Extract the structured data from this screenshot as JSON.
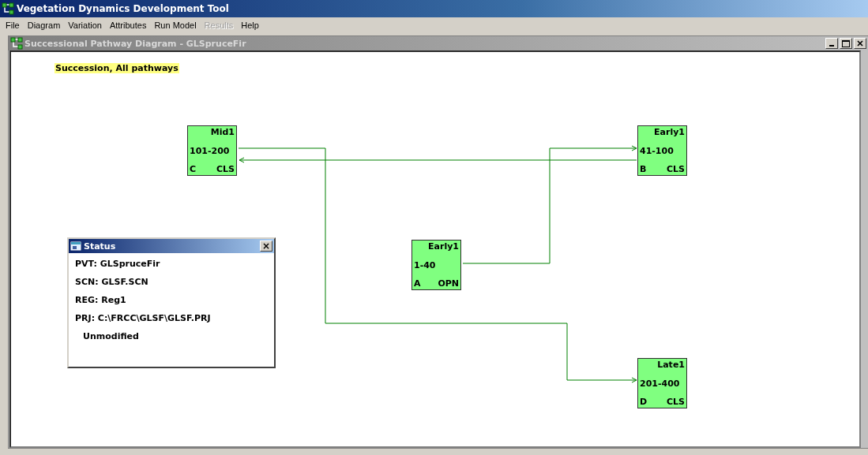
{
  "window": {
    "title": "Vegetation Dynamics Development Tool"
  },
  "menu": [
    {
      "label": "File",
      "disabled": false
    },
    {
      "label": "Diagram",
      "disabled": false
    },
    {
      "label": "Variation",
      "disabled": false
    },
    {
      "label": "Attributes",
      "disabled": false
    },
    {
      "label": "Run Model",
      "disabled": false
    },
    {
      "label": "Results",
      "disabled": true
    },
    {
      "label": "Help",
      "disabled": false
    }
  ],
  "diagram_window": {
    "title": "Successional Pathway Diagram - GLSpruceFir",
    "legend": "Succession, All pathways"
  },
  "nodes": [
    {
      "name": "Mid1",
      "range": "101-200",
      "class": "C",
      "cover": "CLS"
    },
    {
      "name": "Early1",
      "range": "41-100",
      "class": "B",
      "cover": "CLS"
    },
    {
      "name": "Early1",
      "range": "1-40",
      "class": "A",
      "cover": "OPN"
    },
    {
      "name": "Late1",
      "range": "201-400",
      "class": "D",
      "cover": "CLS"
    }
  ],
  "status_window": {
    "title": "Status",
    "close": "×",
    "lines": [
      "PVT: GLSpruceFir",
      "SCN: GLSF.SCN",
      "REG: Reg1",
      "PRJ: C:\\FRCC\\GLSF\\GLSF.PRJ"
    ],
    "state": "Unmodified"
  }
}
